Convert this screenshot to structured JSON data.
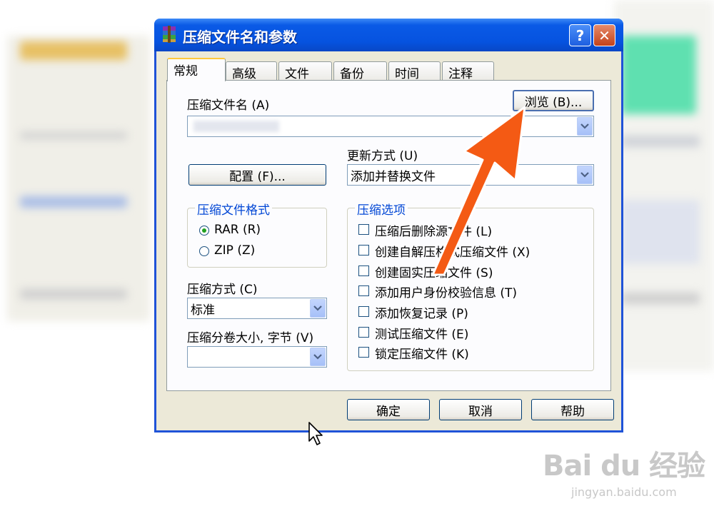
{
  "window": {
    "title": "压缩文件名和参数",
    "help_glyph": "?",
    "close_glyph": "✕"
  },
  "tabs": [
    "常规",
    "高级",
    "文件",
    "备份",
    "时间",
    "注释"
  ],
  "general": {
    "archive_name_label": "压缩文件名 (A)",
    "archive_name_value": "",
    "browse_button": "浏览 (B)...",
    "update_method_label": "更新方式 (U)",
    "update_method_value": "添加并替换文件",
    "profiles_button": "配置 (F)...",
    "format_group_title": "压缩文件格式",
    "format_options": [
      "RAR (R)",
      "ZIP (Z)"
    ],
    "format_selected": "RAR (R)",
    "method_label": "压缩方式 (C)",
    "method_value": "标准",
    "volume_label": "压缩分卷大小, 字节 (V)",
    "volume_value": "",
    "options_group_title": "压缩选项",
    "options": [
      "压缩后删除源文件 (L)",
      "创建自解压格式压缩文件 (X)",
      "创建固实压缩文件 (S)",
      "添加用户身份校验信息 (T)",
      "添加恢复记录 (P)",
      "测试压缩文件 (E)",
      "锁定压缩文件 (K)"
    ]
  },
  "footer": {
    "ok": "确定",
    "cancel": "取消",
    "help": "帮助"
  },
  "colors": {
    "titlebar": "#0653e0",
    "annotation_arrow": "#f45a14",
    "group_title": "#0046d5"
  },
  "watermark": {
    "main": "Bai du 经验",
    "sub": "jingyan.baidu.com"
  }
}
